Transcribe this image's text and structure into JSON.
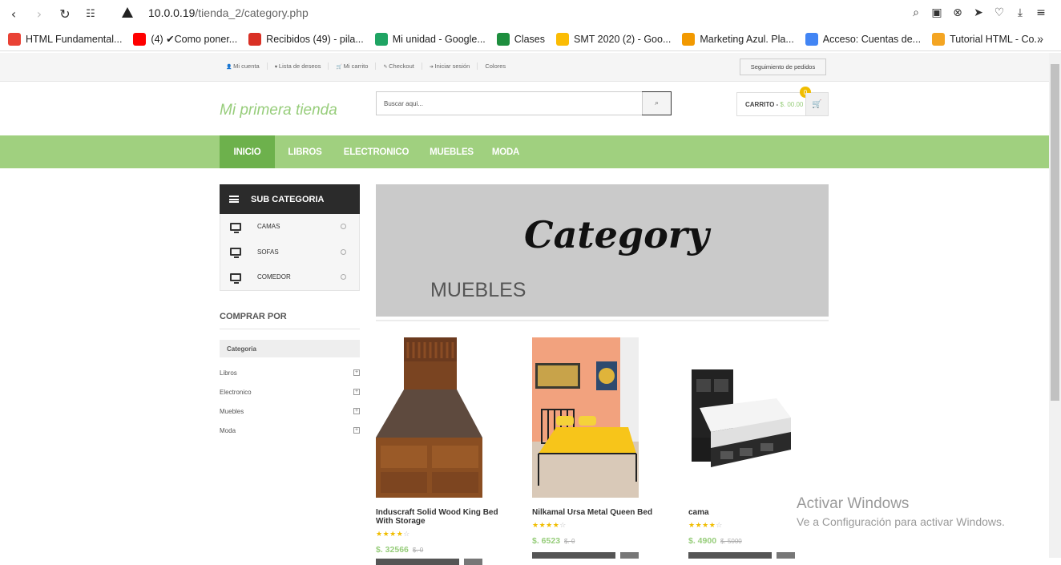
{
  "browser": {
    "url_host": "10.0.0.19",
    "url_path": "/tienda_2/category.php",
    "bookmarks": [
      {
        "label": "HTML Fundamental...",
        "color": "#e94235"
      },
      {
        "label": "(4) ✔Como poner...",
        "color": "#ff0000"
      },
      {
        "label": "Recibidos (49) - pila...",
        "color": "#d93025"
      },
      {
        "label": "Mi unidad - Google...",
        "color": "#1fa463"
      },
      {
        "label": "Clases",
        "color": "#1e8e3e"
      },
      {
        "label": "SMT 2020 (2) - Goo...",
        "color": "#fbbc04"
      },
      {
        "label": "Marketing Azul. Pla...",
        "color": "#f29900"
      },
      {
        "label": "Acceso: Cuentas de...",
        "color": "#4285f4"
      },
      {
        "label": "Tutorial HTML - Co...",
        "color": "#f4a522"
      }
    ],
    "more": "»"
  },
  "topbar": {
    "links": [
      "Mi cuenta",
      "Lista de deseos",
      "Mi carrito",
      "Checkout",
      "Iniciar sesión",
      "Colores"
    ],
    "icons": [
      "user-icon",
      "heart-icon",
      "cart-icon",
      "checkout-icon",
      "login-icon",
      ""
    ],
    "track_label": "Seguimiento de pedidos"
  },
  "header": {
    "logo": "Mi primera tienda",
    "search_placeholder": "Buscar aqui...",
    "cart_label": "CARRITO -",
    "cart_amount": "$. 00.00",
    "cart_count": "0"
  },
  "nav": {
    "items": [
      "INICIO",
      "LIBROS",
      "ELECTRONICO",
      "MUEBLES",
      "MODA"
    ],
    "active": "INICIO",
    "color": "#a0d07f",
    "active_color": "#6db14c"
  },
  "sidebar": {
    "subcat_title": "SUB CATEGORIA",
    "subcats": [
      "CAMAS",
      "SOFAS",
      "COMEDOR"
    ],
    "buy_by": "COMPRAR POR",
    "category_label": "Categoria",
    "filters": [
      "Libros",
      "Electronico",
      "Muebles",
      "Moda"
    ]
  },
  "banner": {
    "script_text": "Category",
    "title": "MUEBLES"
  },
  "products": [
    {
      "title": "Induscraft Solid Wood King Bed With Storage",
      "rating": 4,
      "price": "$. 32566",
      "old_price": "$. 0"
    },
    {
      "title": "Nilkamal Ursa Metal Queen Bed",
      "rating": 4,
      "price": "$. 6523",
      "old_price": "$. 0"
    },
    {
      "title": "cama",
      "rating": 4,
      "price": "$. 4900",
      "old_price": "$. 5000"
    }
  ],
  "watermark": {
    "line1": "Activar Windows",
    "line2": "Ve a Configuración para activar Windows."
  }
}
